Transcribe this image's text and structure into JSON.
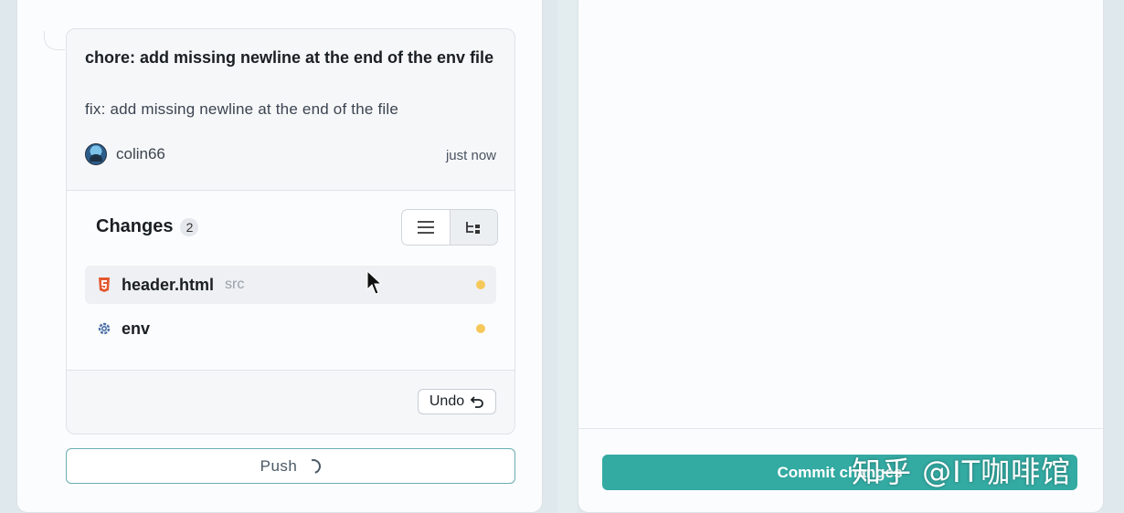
{
  "commit": {
    "title": "chore: add missing newline at the end of the env file",
    "description": "fix: add missing newline at the end of the file",
    "author": "colin66",
    "time": "just now"
  },
  "changes": {
    "title": "Changes",
    "count": "2",
    "files": [
      {
        "name": "header.html",
        "dir": "src",
        "icon": "html5-icon",
        "status_color": "#f5c85a",
        "selected": true
      },
      {
        "name": "env",
        "dir": "",
        "icon": "gear-icon",
        "status_color": "#f5c85a",
        "selected": false
      }
    ]
  },
  "buttons": {
    "undo": "Undo",
    "push": "Push",
    "commit": "Commit changes"
  },
  "view_toggle": {
    "options": [
      "list-view-icon",
      "tree-view-icon"
    ],
    "active": "tree-view-icon"
  },
  "watermark": "知乎 @IT咖啡馆",
  "colors": {
    "accent": "#33aaa2",
    "modified_dot": "#f5c85a",
    "html_icon": "#e4572e"
  }
}
